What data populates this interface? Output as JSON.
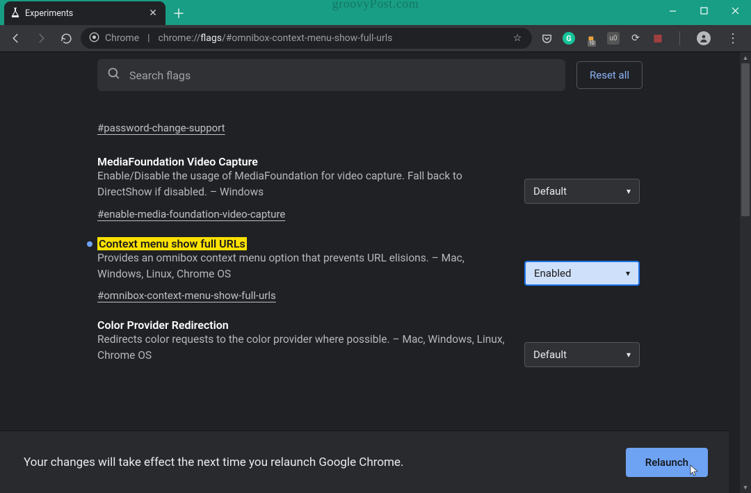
{
  "window": {
    "tab_title": "Experiments",
    "watermark": "groovyPost.com"
  },
  "address_bar": {
    "scheme_icon_label": "Chrome",
    "protocol": "chrome://",
    "host_strong": "flags",
    "fragment": "/#omnibox-context-menu-show-full-urls"
  },
  "extension_badges": {
    "weather_badge": "10"
  },
  "flags_header": {
    "search_placeholder": "Search flags",
    "reset_label": "Reset all"
  },
  "flags": [
    {
      "title": "",
      "desc": "",
      "hash": "#password-change-support",
      "select_value": "",
      "highlighted": false,
      "show_header": false,
      "show_select": false
    },
    {
      "title": "MediaFoundation Video Capture",
      "desc": "Enable/Disable the usage of MediaFoundation for video capture. Fall back to DirectShow if disabled. – Windows",
      "hash": "#enable-media-foundation-video-capture",
      "select_value": "Default",
      "highlighted": false,
      "show_header": true,
      "show_select": true
    },
    {
      "title": "Context menu show full URLs",
      "desc": "Provides an omnibox context menu option that prevents URL elisions. – Mac, Windows, Linux, Chrome OS",
      "hash": "#omnibox-context-menu-show-full-urls",
      "select_value": "Enabled",
      "highlighted": true,
      "show_header": true,
      "show_select": true
    },
    {
      "title": "Color Provider Redirection",
      "desc": "Redirects color requests to the color provider where possible. – Mac, Windows, Linux, Chrome OS",
      "hash": "",
      "select_value": "Default",
      "highlighted": false,
      "show_header": true,
      "show_select": true
    }
  ],
  "bottom": {
    "message": "Your changes will take effect the next time you relaunch Google Chrome.",
    "relaunch_label": "Relaunch"
  }
}
